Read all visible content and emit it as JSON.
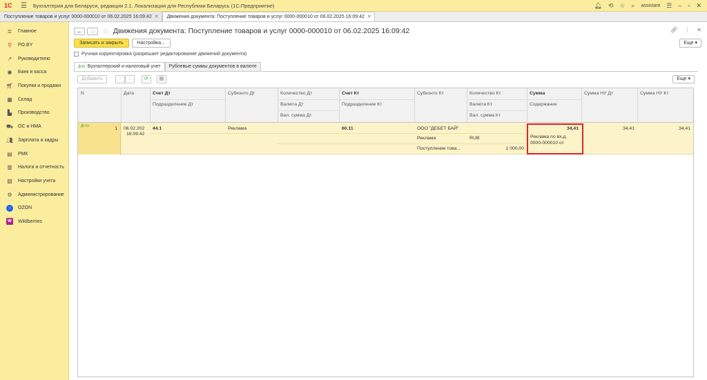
{
  "app": {
    "logo": "1С",
    "title": "Бухгалтерия для Беларуси, редакция 2.1. Локализация для Республики Беларусь   (1С:Предприятие)",
    "user": "assistant"
  },
  "tabs": [
    {
      "label": "Поступление товаров и услуг 0000-000010 от 06.02.2025 16:09:42",
      "active": false
    },
    {
      "label": "Движения документа: Поступление товаров и услуг 0000-000010 от 06.02.2025 16:09:42",
      "active": true
    }
  ],
  "sidebar": {
    "items": [
      {
        "label": "Главное",
        "icon": "menu-icon"
      },
      {
        "label": "PO.BY",
        "icon": "pin-icon"
      },
      {
        "label": "Руководителю",
        "icon": "chart-icon"
      },
      {
        "label": "Банк и касса",
        "icon": "coins-icon"
      },
      {
        "label": "Покупки и продажи",
        "icon": "cart-icon"
      },
      {
        "label": "Склад",
        "icon": "warehouse-icon"
      },
      {
        "label": "Производство",
        "icon": "factory-icon"
      },
      {
        "label": "ОС и НМА",
        "icon": "truck-icon"
      },
      {
        "label": "Зарплата и кадры",
        "icon": "people-icon"
      },
      {
        "label": "РМК",
        "icon": "register-icon"
      },
      {
        "label": "Налоги и отчетность",
        "icon": "tax-icon"
      },
      {
        "label": "Настройки учета",
        "icon": "settings-doc-icon"
      },
      {
        "label": "Администрирование",
        "icon": "gear-icon"
      },
      {
        "label": "OZON",
        "icon": "ozon-icon"
      },
      {
        "label": "Wildberries",
        "icon": "wildberries-icon"
      }
    ]
  },
  "document": {
    "title": "Движения документа: Поступление товаров и услуг 0000-000010 от 06.02.2025 16:09:42",
    "save_close": "Записать и закрыть",
    "settings": "Настройка...",
    "more": "Еще",
    "manual_correction": "Ручная корректировка (разрешает редактирование движений документа)"
  },
  "subtabs": [
    {
      "label": "Бухгалтерский и налоговый учет",
      "active": true
    },
    {
      "label": "Рублевые суммы документов в валюте",
      "active": false
    }
  ],
  "gridbar": {
    "add": "Добавить",
    "more": "Еще"
  },
  "grid": {
    "headers": {
      "n": "N",
      "date": "Дата",
      "acc_dt": "Счет Дт",
      "dept_dt": "Подразделение Дт",
      "subconto_dt": "Субконто Дт",
      "qty_dt": "Количество Дт",
      "cur_dt": "Валюта Дт",
      "cursum_dt": "Вал. сумма Дт",
      "acc_kt": "Счет Кт",
      "dept_kt": "Подразделение Кт",
      "subconto_kt": "Субконто Кт",
      "qty_kt": "Количество Кт",
      "cur_kt": "Валюта Кт",
      "cursum_kt": "Вал. сумма Кт",
      "sum": "Сумма",
      "content": "Содержание",
      "sum_nu_dt": "Сумма НУ Дт",
      "sum_nu_kt": "Сумма НУ Кт"
    },
    "row": {
      "icon": "Дт Кт",
      "n": "1",
      "date_line1": "06.02.202",
      "date_line2": "16:09:42",
      "acc_dt": "44.1",
      "subconto_dt": "Реклама",
      "acc_kt": "60.11",
      "subconto_kt_1": "ООО \"ДЕБЕТ БАЙ\"",
      "subconto_kt_2": "Реклама",
      "subconto_kt_3": "Поступление това...",
      "cur_kt": "RUB",
      "cursum_kt": "1 000,00",
      "sum": "34,41",
      "content_line1": "Реклама по вх.д.",
      "content_line2": "0000-000010 от",
      "sum_nu_dt": "34,41",
      "sum_nu_kt": "34,41"
    }
  }
}
